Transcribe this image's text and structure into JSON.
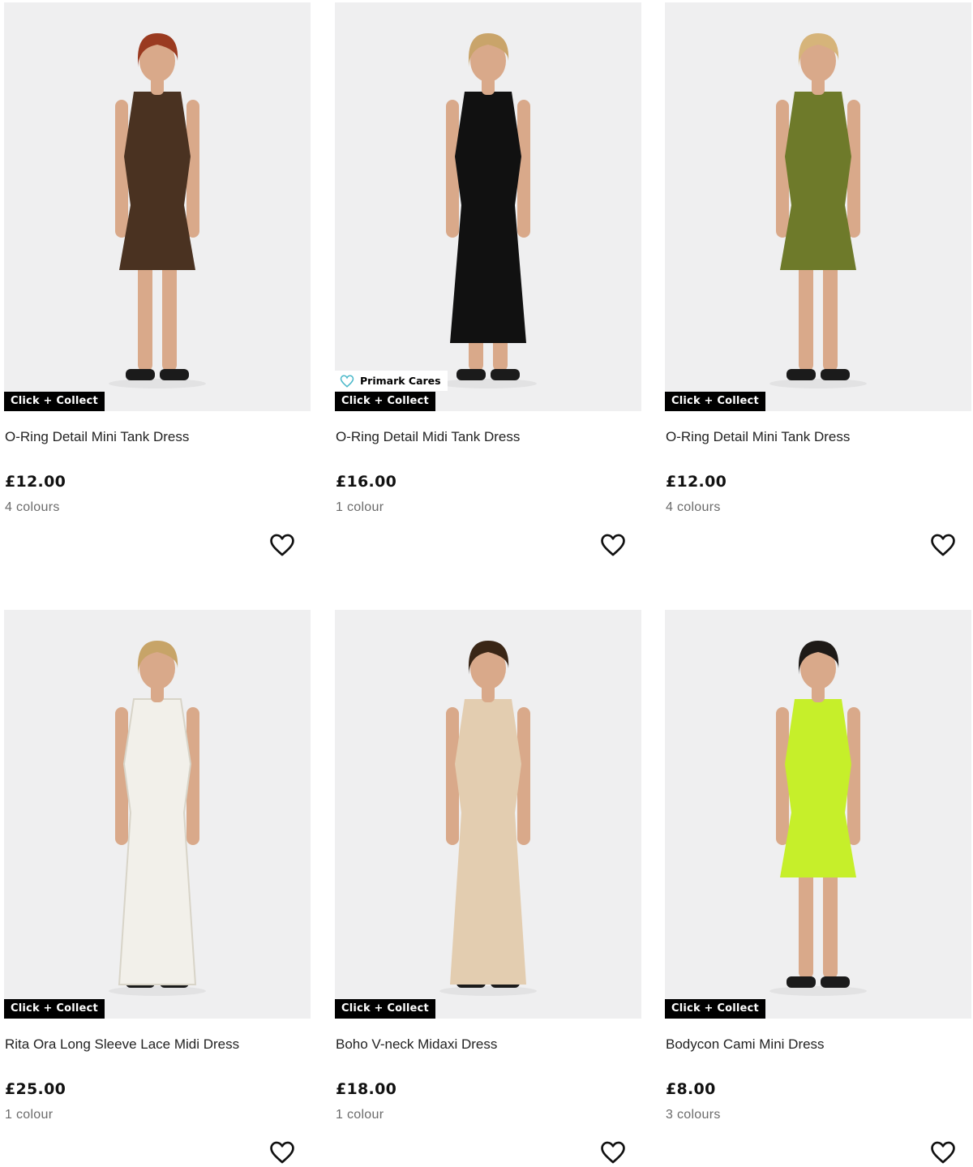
{
  "products": [
    {
      "title": "O-Ring Detail Mini Tank Dress",
      "price": "£12.00",
      "colours": "4 colours",
      "badge": "Click + Collect",
      "dress_color": "#4a3221",
      "dress_length": "mini",
      "hair": "#9a3a20"
    },
    {
      "title": "O-Ring Detail Midi Tank Dress",
      "price": "£16.00",
      "colours": "1 colour",
      "badge": "Click + Collect",
      "extra_badge": "Primark Cares",
      "dress_color": "#111111",
      "dress_length": "midi",
      "hair": "#c9a46a"
    },
    {
      "title": "O-Ring Detail Mini Tank Dress",
      "price": "£12.00",
      "colours": "4 colours",
      "badge": "Click + Collect",
      "dress_color": "#6e7a2a",
      "dress_length": "mini",
      "hair": "#d6b47a"
    },
    {
      "title": "Rita Ora Long Sleeve Lace Midi Dress",
      "price": "£25.00",
      "colours": "1 colour",
      "badge": "Click + Collect",
      "dress_color": "#f2f0ea",
      "dress_length": "long",
      "hair": "#c7a468"
    },
    {
      "title": "Boho V-neck Midaxi Dress",
      "price": "£18.00",
      "colours": "1 colour",
      "badge": "Click + Collect",
      "dress_color": "#e3cdb0",
      "dress_length": "long",
      "hair": "#3a2616"
    },
    {
      "title": "Bodycon Cami Mini Dress",
      "price": "£8.00",
      "colours": "3 colours",
      "badge": "Click + Collect",
      "dress_color": "#c6ef2a",
      "dress_length": "mini",
      "hair": "#1e1a17"
    }
  ],
  "icons": {
    "favourite": "heart-outline-icon",
    "cares": "heart-icon"
  },
  "colors": {
    "image_bg": "#efeff0",
    "badge_bg": "#000000",
    "cares_icon": "#4ab8c9"
  }
}
